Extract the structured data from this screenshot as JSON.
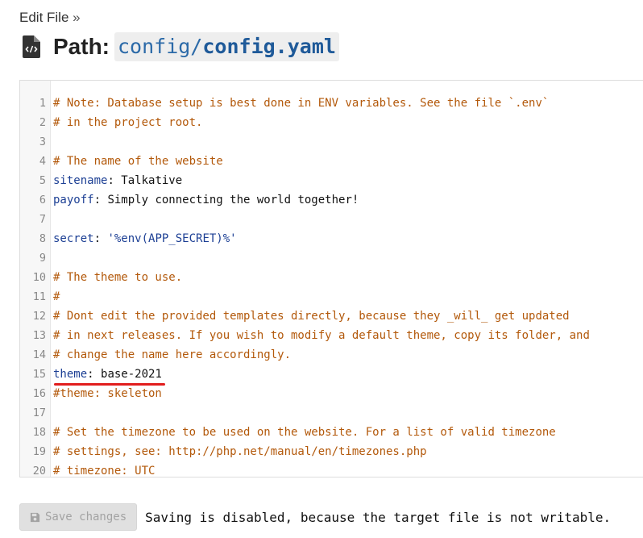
{
  "breadcrumb": {
    "label": "Edit File",
    "separator": "»"
  },
  "title": {
    "label": "Path:",
    "path_dir": "config/",
    "path_file": "config.yaml"
  },
  "editor": {
    "lines": [
      {
        "n": "1",
        "parts": [
          {
            "t": "c",
            "v": "# Note: Database setup is best done in ENV variables. See the file `.env`"
          }
        ]
      },
      {
        "n": "2",
        "parts": [
          {
            "t": "c",
            "v": "# in the project root."
          }
        ]
      },
      {
        "n": "3",
        "parts": []
      },
      {
        "n": "4",
        "parts": [
          {
            "t": "c",
            "v": "# The name of the website"
          }
        ]
      },
      {
        "n": "5",
        "parts": [
          {
            "t": "k",
            "v": "sitename"
          },
          {
            "t": "p",
            "v": ": "
          },
          {
            "t": "p",
            "v": "Talkative"
          }
        ]
      },
      {
        "n": "6",
        "parts": [
          {
            "t": "k",
            "v": "payoff"
          },
          {
            "t": "p",
            "v": ": "
          },
          {
            "t": "p",
            "v": "Simply connecting the world together!"
          }
        ]
      },
      {
        "n": "7",
        "parts": []
      },
      {
        "n": "8",
        "parts": [
          {
            "t": "k",
            "v": "secret"
          },
          {
            "t": "p",
            "v": ": "
          },
          {
            "t": "s",
            "v": "'%env(APP_SECRET)%'"
          }
        ]
      },
      {
        "n": "9",
        "parts": []
      },
      {
        "n": "10",
        "parts": [
          {
            "t": "c",
            "v": "# The theme to use."
          }
        ]
      },
      {
        "n": "11",
        "parts": [
          {
            "t": "c",
            "v": "#"
          }
        ]
      },
      {
        "n": "12",
        "parts": [
          {
            "t": "c",
            "v": "# Dont edit the provided templates directly, because they _will_ get updated"
          }
        ]
      },
      {
        "n": "13",
        "parts": [
          {
            "t": "c",
            "v": "# in next releases. If you wish to modify a default theme, copy its folder, and"
          }
        ]
      },
      {
        "n": "14",
        "parts": [
          {
            "t": "c",
            "v": "# change the name here accordingly."
          }
        ]
      },
      {
        "n": "15",
        "parts": [
          {
            "t": "k",
            "v": "theme"
          },
          {
            "t": "p",
            "v": ": "
          },
          {
            "t": "p",
            "v": "base-2021"
          }
        ],
        "marked": true
      },
      {
        "n": "16",
        "parts": [
          {
            "t": "c",
            "v": "#theme: skeleton"
          }
        ]
      },
      {
        "n": "17",
        "parts": []
      },
      {
        "n": "18",
        "parts": [
          {
            "t": "c",
            "v": "# Set the timezone to be used on the website. For a list of valid timezone"
          }
        ]
      },
      {
        "n": "19",
        "parts": [
          {
            "t": "c",
            "v": "# settings, see: http://php.net/manual/en/timezones.php"
          }
        ]
      },
      {
        "n": "20",
        "parts": [
          {
            "t": "c",
            "v": "# timezone: UTC"
          }
        ]
      }
    ]
  },
  "footer": {
    "save_label": "Save changes",
    "message": "Saving is disabled, because the target file is not writable."
  },
  "colors": {
    "comment": "#b3590b",
    "key": "#1c3f94",
    "path": "#2c6aa8",
    "underline": "#e11d1d"
  },
  "icons": {
    "title": "file-code-icon",
    "save": "save-icon"
  }
}
